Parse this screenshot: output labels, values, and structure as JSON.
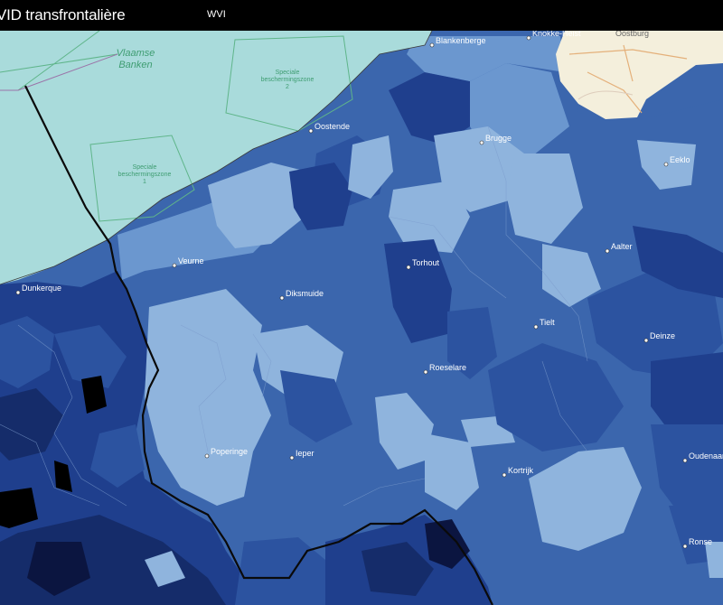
{
  "header": {
    "title": "VID transfrontalière",
    "layer_label": "WVI"
  },
  "colors": {
    "header_bg": "#000000",
    "sea": "#a9dbdb",
    "very_light": "#8fb4dd",
    "light": "#6b97cf",
    "medium": "#3b66ad",
    "dark": "#2c53a0",
    "darker": "#1f3f8d",
    "very_dark": "#152c6a",
    "darkest": "#0b1540",
    "black": "#000000",
    "border_line": "#111111",
    "zone_line": "#5fb58a",
    "basemap": "#f4efdc"
  },
  "sea_labels": {
    "banks": "Vlaamse\nBanken",
    "zone_right": "Speciale\nbeschermingszone\n2",
    "zone_left": "Speciale\nbeschermingszone\n1"
  },
  "cities": [
    {
      "name": "Blankenberge"
    },
    {
      "name": "Knokke-Heist"
    },
    {
      "name": "Oostende"
    },
    {
      "name": "Brugge"
    },
    {
      "name": "Eeklo"
    },
    {
      "name": "Veurne"
    },
    {
      "name": "Torhout"
    },
    {
      "name": "Aalter"
    },
    {
      "name": "Dunkerque"
    },
    {
      "name": "Diksmuide"
    },
    {
      "name": "Tielt"
    },
    {
      "name": "Deinze"
    },
    {
      "name": "Roeselare"
    },
    {
      "name": "Poperinge"
    },
    {
      "name": "Ieper"
    },
    {
      "name": "Kortrijk"
    },
    {
      "name": "Oudenaarde"
    },
    {
      "name": "Ronse"
    },
    {
      "name": "Oostburg"
    }
  ]
}
